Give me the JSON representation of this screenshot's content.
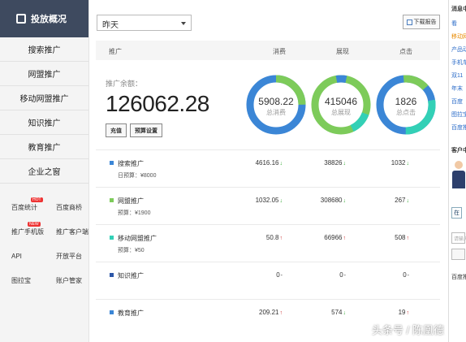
{
  "sidebar": {
    "active": "投放概况",
    "items": [
      "搜索推广",
      "网盟推广",
      "移动网盟推广",
      "知识推广",
      "教育推广",
      "企业之窗"
    ],
    "grid": [
      [
        "百度统计",
        "百度商桥"
      ],
      [
        "推广手机版",
        "推广客户端"
      ],
      [
        "API",
        "开放平台"
      ],
      [
        "图拉宝",
        "账户管家"
      ]
    ],
    "hot_badge": "HOT",
    "new_badge": "NEW"
  },
  "toolbar": {
    "date_range": "昨天",
    "download_label": "下载报告"
  },
  "table_header": {
    "col_promo": "推广",
    "col_cost": "消费",
    "col_impr": "展现",
    "col_click": "点击"
  },
  "summary": {
    "balance_label": "推广余额：",
    "balance": "126062.28",
    "recharge_label": "充值",
    "budget_label": "预算设置",
    "cost": "5908.22",
    "cost_caption": "总消费",
    "impressions": "415046",
    "impressions_caption": "总展现",
    "clicks": "1826",
    "clicks_caption": "总点击",
    "colors": {
      "blue": "#3b86d6",
      "green": "#7dcb5a",
      "teal": "#33d0b6"
    }
  },
  "rows": [
    {
      "name": "搜索推广",
      "sub": "日预算：¥8000",
      "color": "#3b86d6",
      "cost": "4616.16",
      "cost_dir": "down",
      "impr": "38826",
      "impr_dir": "down",
      "click": "1032",
      "click_dir": "down"
    },
    {
      "name": "网盟推广",
      "sub": "预算：¥1900",
      "color": "#7dcb5a",
      "cost": "1032.05",
      "cost_dir": "down",
      "impr": "308680",
      "impr_dir": "down",
      "click": "267",
      "click_dir": "down"
    },
    {
      "name": "移动网盟推广",
      "sub": "预算：¥50",
      "color": "#33d0b6",
      "cost": "50.8",
      "cost_dir": "up",
      "impr": "66966",
      "impr_dir": "up",
      "click": "508",
      "click_dir": "up"
    },
    {
      "name": "知识推广",
      "sub": "",
      "color": "#2d57a8",
      "cost": "0",
      "cost_dir": "none",
      "impr": "0",
      "impr_dir": "none",
      "click": "0",
      "click_dir": "none"
    },
    {
      "name": "教育推广",
      "sub": "",
      "color": "#3b86d6",
      "cost": "209.21",
      "cost_dir": "up",
      "impr": "574",
      "impr_dir": "down",
      "click": "19",
      "click_dir": "up"
    }
  ],
  "right_panel": {
    "title": "消息中",
    "lines": [
      "看",
      "移动网",
      "产品动",
      "手机车",
      "双11",
      "年末",
      "百度",
      "图拉宝",
      "百度推"
    ],
    "cs_title": "客户中",
    "online": "在",
    "input_hint": "请输入",
    "bottom": "百度推"
  },
  "watermark": "头条号 / 陈凰德"
}
